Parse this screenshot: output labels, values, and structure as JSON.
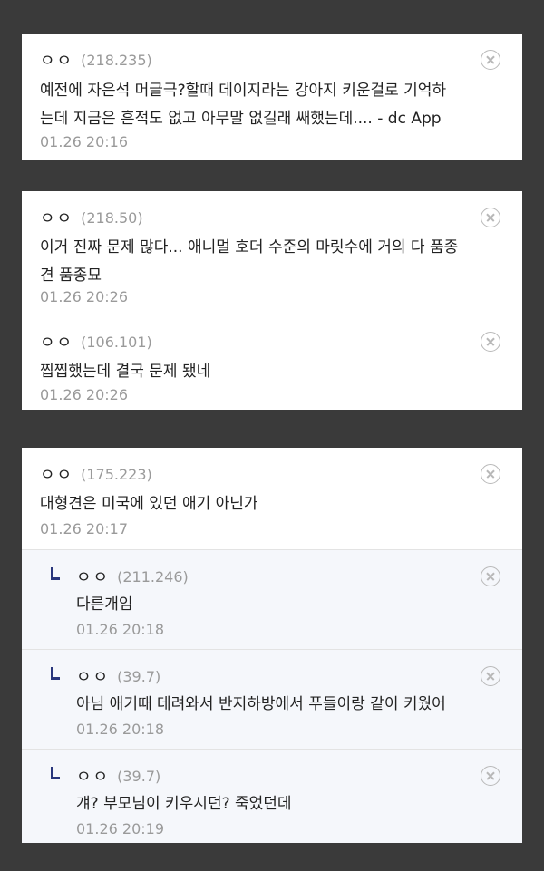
{
  "groups": [
    {
      "comments": [
        {
          "nickname": "ㅇㅇ",
          "ip": "(218.235)",
          "lines": [
            "예전에 자은석 머글극?할때 데이지라는 강아지 키운걸로 기억하",
            "는데 지금은 흔적도 없고 아무말 없길래 쌔했는데.... - dc App"
          ],
          "date": "01.26 20:16"
        }
      ]
    },
    {
      "comments": [
        {
          "nickname": "ㅇㅇ",
          "ip": "(218.50)",
          "lines": [
            "이거 진짜 문제 많다... 애니멀 호더 수준의 마릿수에 거의 다 품종",
            "견 품종묘"
          ],
          "date": "01.26 20:26"
        },
        {
          "nickname": "ㅇㅇ",
          "ip": "(106.101)",
          "lines": [
            "찝찝했는데 결국 문제 됐네"
          ],
          "date": "01.26 20:26"
        }
      ]
    },
    {
      "comments": [
        {
          "nickname": "ㅇㅇ",
          "ip": "(175.223)",
          "lines": [
            "대형견은 미국에 있던 애기 아닌가"
          ],
          "date": "01.26 20:17"
        },
        {
          "nickname": "ㅇㅇ",
          "ip": "(211.246)",
          "lines": [
            "다른개임"
          ],
          "date": "01.26 20:18",
          "reply": true
        },
        {
          "nickname": "ㅇㅇ",
          "ip": "(39.7)",
          "lines": [
            "아님 애기때 데려와서 반지하방에서 푸들이랑 같이 키웠어"
          ],
          "date": "01.26 20:18",
          "reply": true
        },
        {
          "nickname": "ㅇㅇ",
          "ip": "(39.7)",
          "lines": [
            "걔? 부모님이 키우시던? 죽었던데"
          ],
          "date": "01.26 20:19",
          "reply": true
        }
      ]
    }
  ],
  "icons": {
    "delete": "close-circle-icon",
    "reply": "reply-arrow-icon"
  },
  "colors": {
    "background": "#3a3a3a",
    "reply_background": "#f5f7fb",
    "reply_mark": "#29367c",
    "meta_text": "#9a9a9a"
  }
}
